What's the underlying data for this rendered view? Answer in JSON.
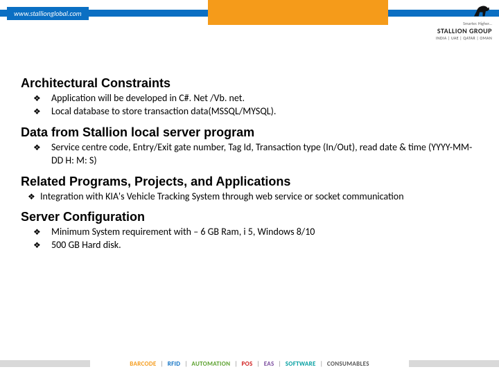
{
  "header": {
    "url": "www.stallionglobal.com",
    "tagline": "Smarter.  Higher...",
    "brand": "STALLION GROUP",
    "regions": "INDIA | UAE | QATAR | OMAN"
  },
  "sections": [
    {
      "title": "Architectural Constraints",
      "style": "indent",
      "items": [
        "Application will be developed in C#. Net /Vb. net.",
        "Local database to store transaction data(MSSQL/MYSQL)."
      ]
    },
    {
      "title": "Data from Stallion local server program",
      "style": "indent",
      "items": [
        "Service centre code, Entry/Exit gate number, Tag Id, Transaction type (In/Out), read date & time (YYYY-MM-DD H: M: S)"
      ]
    },
    {
      "title": "Related Programs, Projects, and Applications",
      "style": "tight",
      "items": [
        "Integration with KIA's Vehicle Tracking System through web service or socket communication"
      ]
    },
    {
      "title": "Server Configuration",
      "style": "indent",
      "items": [
        "Minimum System requirement with – 6 GB Ram, i 5, Windows 8/10",
        "500 GB Hard disk."
      ]
    }
  ],
  "footer": {
    "categories": [
      "BARCODE",
      "RFID",
      "AUTOMATION",
      "POS",
      "EAS",
      "SOFTWARE",
      "CONSUMABLES"
    ]
  }
}
